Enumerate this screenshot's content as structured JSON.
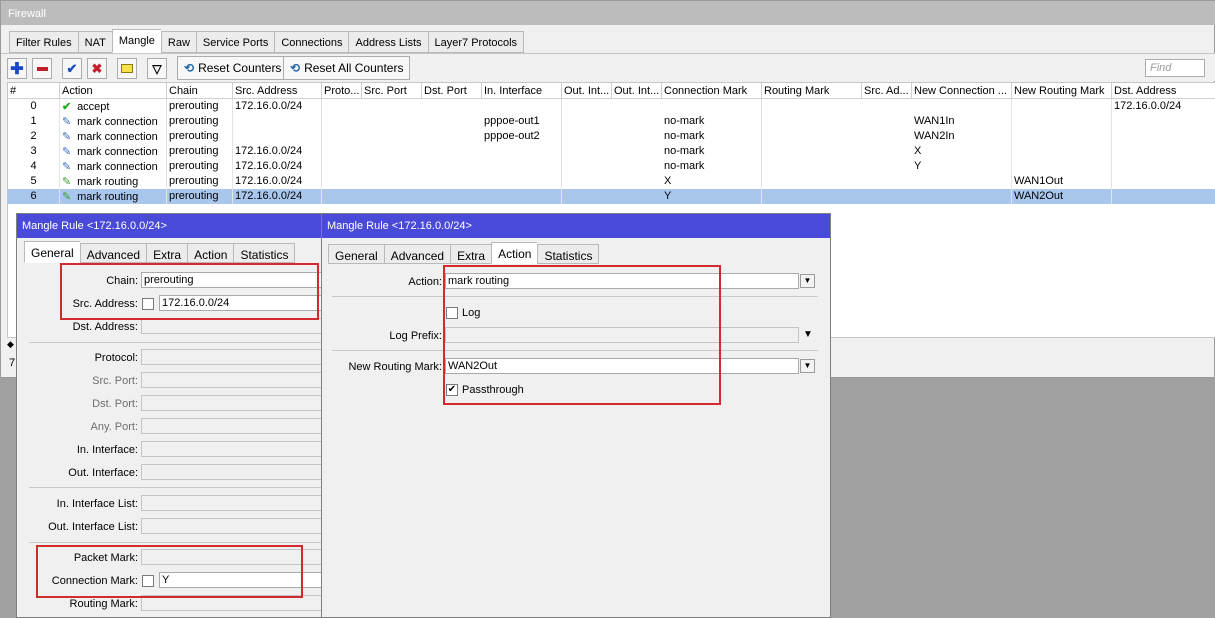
{
  "window_title": "Firewall",
  "tabs": [
    "Filter Rules",
    "NAT",
    "Mangle",
    "Raw",
    "Service Ports",
    "Connections",
    "Address Lists",
    "Layer7 Protocols"
  ],
  "active_tab": "Mangle",
  "toolbar": {
    "add_icon": "plus-icon",
    "remove_icon": "minus-icon",
    "enable_icon": "check-icon",
    "disable_icon": "x-icon",
    "comment_icon": "comment-icon",
    "filter_icon": "filter-icon",
    "reset_counters": "Reset Counters",
    "reset_all_counters": "Reset All Counters",
    "find_placeholder": "Find"
  },
  "table": {
    "columns": [
      "#",
      "Action",
      "Chain",
      "Src. Address",
      "Proto...",
      "Src. Port",
      "Dst. Port",
      "In. Interface",
      "Out. Int...",
      "Out. Int...",
      "Connection Mark",
      "Routing Mark",
      "Src. Ad...",
      "New Connection ...",
      "New Routing Mark",
      "Dst. Address"
    ],
    "rows": [
      {
        "num": "0",
        "action": "accept",
        "icon": "accept-icon",
        "chain": "prerouting",
        "src": "172.16.0.0/24",
        "in_if": "",
        "conn_mark": "",
        "new_conn": "",
        "new_route": "",
        "dst": "172.16.0.0/24"
      },
      {
        "num": "1",
        "action": "mark connection",
        "icon": "mark-connection-icon",
        "chain": "prerouting",
        "src": "",
        "in_if": "pppoe-out1",
        "conn_mark": "no-mark",
        "new_conn": "WAN1In",
        "new_route": "",
        "dst": ""
      },
      {
        "num": "2",
        "action": "mark connection",
        "icon": "mark-connection-icon",
        "chain": "prerouting",
        "src": "",
        "in_if": "pppoe-out2",
        "conn_mark": "no-mark",
        "new_conn": "WAN2In",
        "new_route": "",
        "dst": ""
      },
      {
        "num": "3",
        "action": "mark connection",
        "icon": "mark-connection-icon",
        "chain": "prerouting",
        "src": "172.16.0.0/24",
        "in_if": "",
        "conn_mark": "no-mark",
        "new_conn": "X",
        "new_route": "",
        "dst": ""
      },
      {
        "num": "4",
        "action": "mark connection",
        "icon": "mark-connection-icon",
        "chain": "prerouting",
        "src": "172.16.0.0/24",
        "in_if": "",
        "conn_mark": "no-mark",
        "new_conn": "Y",
        "new_route": "",
        "dst": ""
      },
      {
        "num": "5",
        "action": "mark routing",
        "icon": "mark-routing-icon",
        "chain": "prerouting",
        "src": "172.16.0.0/24",
        "in_if": "",
        "conn_mark": "X",
        "new_conn": "",
        "new_route": "WAN1Out",
        "dst": ""
      },
      {
        "num": "6",
        "action": "mark routing",
        "icon": "mark-routing-icon",
        "chain": "prerouting",
        "src": "172.16.0.0/24",
        "in_if": "",
        "conn_mark": "Y",
        "new_conn": "",
        "new_route": "WAN2Out",
        "dst": ""
      }
    ],
    "selected_row": "6"
  },
  "status_bar": {
    "count": "7"
  },
  "left_dialog": {
    "title": "Mangle Rule <172.16.0.0/24>",
    "tabs": [
      "General",
      "Advanced",
      "Extra",
      "Action",
      "Statistics"
    ],
    "active_tab": "General",
    "labels": {
      "chain": "Chain:",
      "src_address": "Src. Address:",
      "dst_address": "Dst. Address:",
      "protocol": "Protocol:",
      "src_port": "Src. Port:",
      "dst_port": "Dst. Port:",
      "any_port": "Any. Port:",
      "in_interface": "In. Interface:",
      "out_interface": "Out. Interface:",
      "in_interface_list": "In. Interface List:",
      "out_interface_list": "Out. Interface List:",
      "packet_mark": "Packet Mark:",
      "connection_mark": "Connection Mark:",
      "routing_mark": "Routing Mark:"
    },
    "values": {
      "chain": "prerouting",
      "src_address": "172.16.0.0/24",
      "connection_mark": "Y"
    }
  },
  "right_dialog": {
    "title": "Mangle Rule <172.16.0.0/24>",
    "tabs": [
      "General",
      "Advanced",
      "Extra",
      "Action",
      "Statistics"
    ],
    "active_tab": "Action",
    "labels": {
      "action": "Action:",
      "log": "Log",
      "log_prefix": "Log Prefix:",
      "new_routing_mark": "New Routing Mark:",
      "passthrough": "Passthrough"
    },
    "values": {
      "action": "mark routing",
      "log_prefix": "",
      "new_routing_mark": "WAN2Out"
    },
    "log_checked": false,
    "passthrough_checked": true
  },
  "colors": {
    "dialog_title_bg": "#4a4ad8",
    "selection": "#a9c6ed",
    "highlight_box": "#d32a2e"
  }
}
